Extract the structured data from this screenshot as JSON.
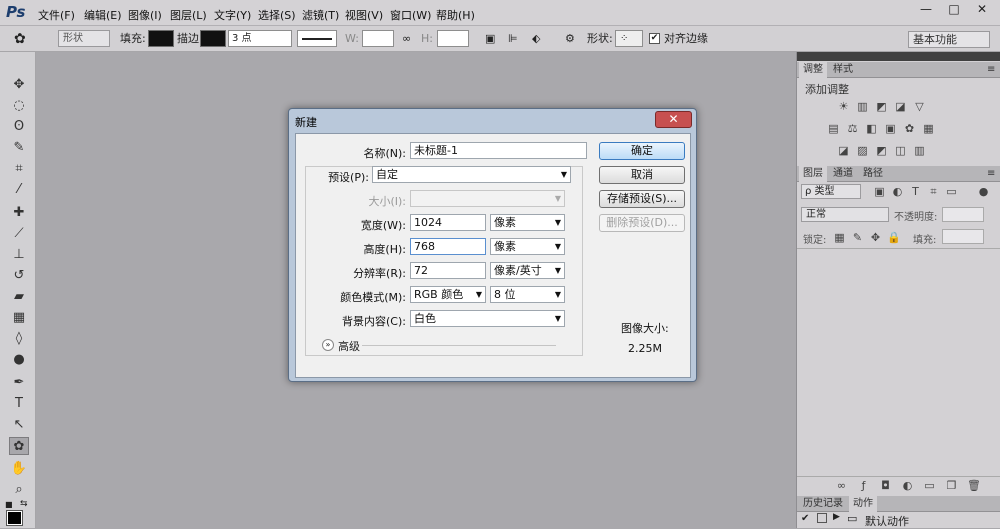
{
  "app": {
    "logo": "Ps"
  },
  "menubar": {
    "items": [
      "文件(F)",
      "编辑(E)",
      "图像(I)",
      "图层(L)",
      "文字(Y)",
      "选择(S)",
      "滤镜(T)",
      "视图(V)",
      "窗口(W)",
      "帮助(H)"
    ],
    "window_buttons": [
      "—",
      "□",
      "✕"
    ]
  },
  "options": {
    "mode": "形状",
    "fill_label": "填充:",
    "stroke_label": "描边:",
    "stroke_width": "3 点",
    "w_label": "W:",
    "h_label": "H:",
    "shape_label": "形状:",
    "align_edges": "对齐边缘",
    "workspace": "基本功能"
  },
  "panels": {
    "adjust_tabs": [
      "调整",
      "样式"
    ],
    "adjust_title": "添加调整",
    "layers_tabs": [
      "图层",
      "通道",
      "路径"
    ],
    "filter_kind": "ρ 类型",
    "blend_mode": "正常",
    "opacity_label": "不透明度:",
    "lock_label": "锁定:",
    "fill_label": "填充:",
    "bottom_tabs": [
      "历史记录",
      "动作"
    ],
    "action_item": "默认动作"
  },
  "dialog": {
    "title": "新建",
    "close": "✕",
    "name_label": "名称(N):",
    "name_value": "未标题-1",
    "preset_label": "预设(P):",
    "preset_value": "自定",
    "size_label": "大小(I):",
    "width_label": "宽度(W):",
    "width_value": "1024",
    "width_unit": "像素",
    "height_label": "高度(H):",
    "height_value": "768",
    "height_unit": "像素",
    "resolution_label": "分辨率(R):",
    "resolution_value": "72",
    "resolution_unit": "像素/英寸",
    "color_mode_label": "颜色模式(M):",
    "color_mode_value": "RGB 颜色",
    "bit_depth": "8 位",
    "background_label": "背景内容(C):",
    "background_value": "白色",
    "advanced_label": "高级",
    "ok": "确定",
    "cancel": "取消",
    "save_preset": "存储预设(S)...",
    "delete_preset": "删除预设(D)...",
    "image_size_label": "图像大小:",
    "image_size_value": "2.25M"
  }
}
